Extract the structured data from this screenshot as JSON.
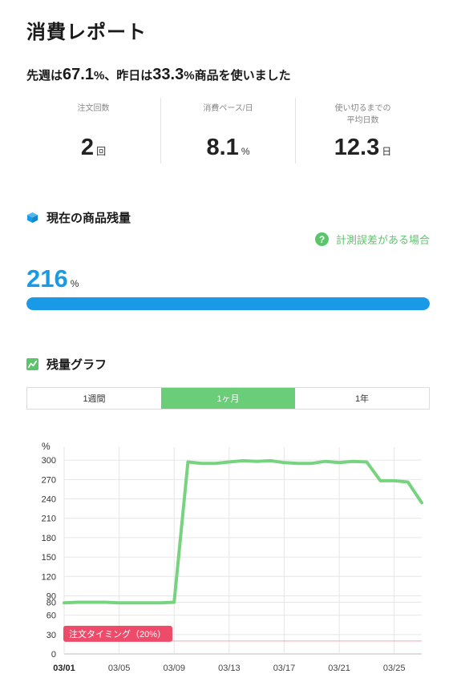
{
  "page": {
    "title": "消費レポート",
    "summary": {
      "prefix": "先週は",
      "last_week_value": "67.1",
      "mid1": "%、昨日は",
      "yesterday_value": "33.3",
      "suffix": "%商品を使いました"
    }
  },
  "stats": [
    {
      "label": "注文回数",
      "value": "2",
      "unit": "回"
    },
    {
      "label": "消費ペース/日",
      "value": "8.1",
      "unit": "%"
    },
    {
      "label": "使い切るまでの\n平均日数",
      "value": "12.3",
      "unit": "日"
    }
  ],
  "current": {
    "section_title": "現在の商品残量",
    "help_label": "計測誤差がある場合",
    "help_icon": "question-icon",
    "value": "216",
    "unit": "%",
    "fill_fraction": 1.0
  },
  "graph": {
    "section_title": "残量グラフ",
    "tabs": [
      {
        "label": "1週間",
        "active": false
      },
      {
        "label": "1ヶ月",
        "active": true
      },
      {
        "label": "1年",
        "active": false
      }
    ]
  },
  "colors": {
    "accent_blue": "#1a9ae6",
    "accent_green": "#5cc46b",
    "line_green": "#77d37f",
    "order_marker": "#ee4b6a"
  },
  "chart_data": {
    "type": "line",
    "ylabel": "%",
    "y_ticks": [
      0,
      30,
      60,
      80,
      90,
      120,
      150,
      180,
      210,
      240,
      270,
      300
    ],
    "ylim": [
      0,
      320
    ],
    "x_ticks": [
      "03/01",
      "03/05",
      "03/09",
      "03/13",
      "03/17",
      "03/21",
      "03/25"
    ],
    "x": [
      "03/01",
      "03/02",
      "03/03",
      "03/04",
      "03/05",
      "03/06",
      "03/07",
      "03/08",
      "03/09",
      "03/10",
      "03/11",
      "03/12",
      "03/13",
      "03/14",
      "03/15",
      "03/16",
      "03/17",
      "03/18",
      "03/19",
      "03/20",
      "03/21",
      "03/22",
      "03/23",
      "03/24",
      "03/25",
      "03/26",
      "03/27"
    ],
    "series": [
      {
        "values": [
          79,
          80,
          80,
          80,
          79,
          79,
          79,
          79,
          80,
          297,
          295,
          295,
          297,
          299,
          298,
          299,
          296,
          295,
          295,
          298,
          296,
          298,
          297,
          268,
          268,
          266,
          234
        ]
      }
    ],
    "threshold": {
      "label": "注文タイミング（20%）",
      "value": 20
    },
    "grid": true
  }
}
